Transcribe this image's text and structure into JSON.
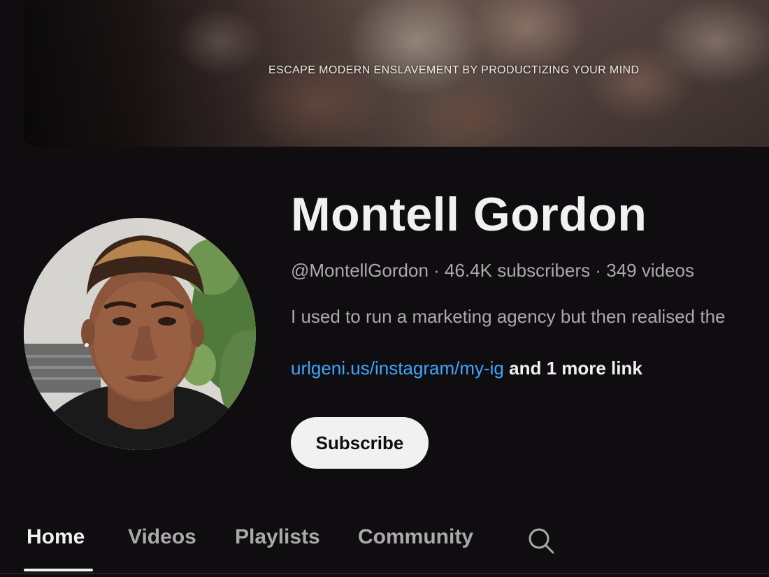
{
  "banner": {
    "tagline": "ESCAPE MODERN ENSLAVEMENT BY PRODUCTIZING YOUR MIND"
  },
  "channel": {
    "name": "Montell Gordon",
    "meta": "@MontellGordon · 46.4K subscribers · 349 videos",
    "description": "I used to run a marketing agency but then realised the",
    "link": "urlgeni.us/instagram/my-ig",
    "more_links": "and 1 more link",
    "subscribe_label": "Subscribe"
  },
  "tabs": [
    {
      "label": "Home",
      "active": true
    },
    {
      "label": "Videos",
      "active": false
    },
    {
      "label": "Playlists",
      "active": false
    },
    {
      "label": "Community",
      "active": false
    }
  ],
  "icons": {
    "tab_search": "search-icon"
  },
  "colors": {
    "background": "#0f0d0f",
    "link": "#3ea6ff",
    "primary_text": "#f1f1f1",
    "secondary_text": "#aaaaaa",
    "subscribe_bg": "#f1f1f1"
  }
}
